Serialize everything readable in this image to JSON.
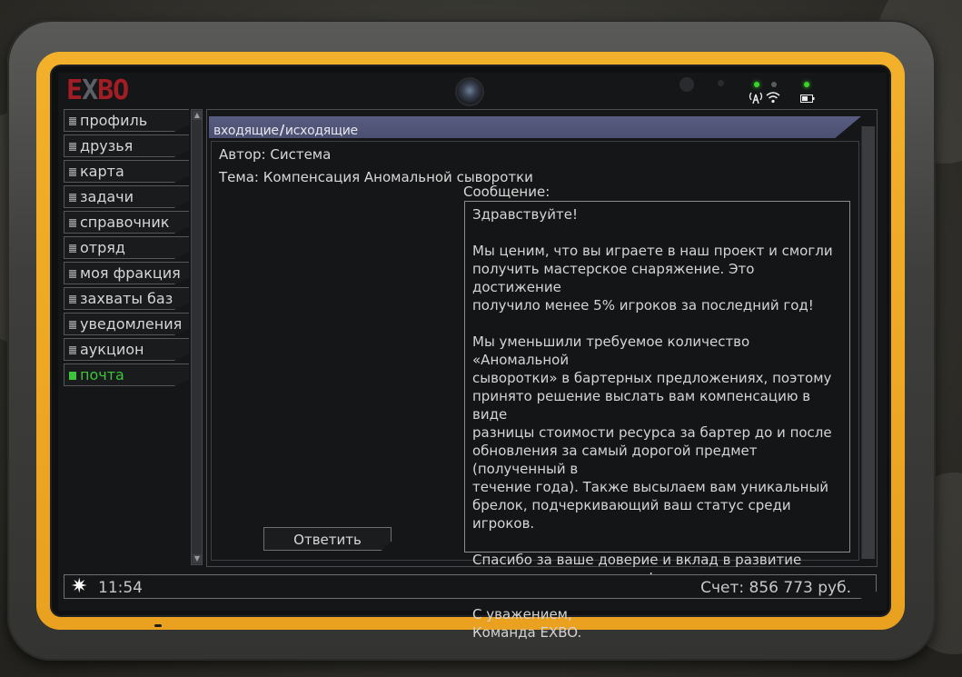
{
  "logo": {
    "left": "E",
    "mid": "X",
    "right": "BO"
  },
  "status": {
    "signal_icon": "antenna-icon",
    "wifi_icon": "wifi-icon",
    "battery_icon": "battery-icon"
  },
  "sidebar": {
    "items": [
      {
        "label": "профиль",
        "active": false
      },
      {
        "label": "друзья",
        "active": false
      },
      {
        "label": "карта",
        "active": false
      },
      {
        "label": "задачи",
        "active": false
      },
      {
        "label": "справочник",
        "active": false
      },
      {
        "label": "отряд",
        "active": false
      },
      {
        "label": "моя фракция",
        "active": false
      },
      {
        "label": "захваты баз",
        "active": false
      },
      {
        "label": "уведомления",
        "active": false
      },
      {
        "label": "аукцион",
        "active": false
      },
      {
        "label": "почта",
        "active": true
      }
    ]
  },
  "mail": {
    "tab_inbox": "входящие",
    "tab_sep": "/",
    "tab_outbox": "исходящие",
    "author": "Автор: Система",
    "subject": "Тема: Компенсация Аномальной сыворотки",
    "message_label": "Сообщение:",
    "message_body": "Здравствуйте!\n\nМы ценим, что вы играете в наш проект и смогли\nполучить мастерское снаряжение. Это достижение\nполучило менее 5% игроков за последний год!\n\nМы уменьшили требуемое количество «Аномальной\nсыворотки» в бартерных предложениях, поэтому\nпринято решение выслать вам компенсацию в виде\nразницы стоимости ресурса за бартер до и после\nобновления за самый дорогой предмет (полученный в\nтечение года). Также высылаем вам уникальный\nбрелок, подчеркивающий ваш статус среди игроков.\n\nСпасибо за ваше доверие и вклад в развитие\nмастерского комьюнити!\n\nС уважением,\nКоманда EXBO.",
    "reply_label": "Ответить"
  },
  "bottombar": {
    "time": "11:54",
    "balance": "Счет: 856 773 руб."
  },
  "colors": {
    "accent_active": "#3cc53a",
    "frame": "#e9a11f",
    "logo_red": "#a31d25"
  }
}
